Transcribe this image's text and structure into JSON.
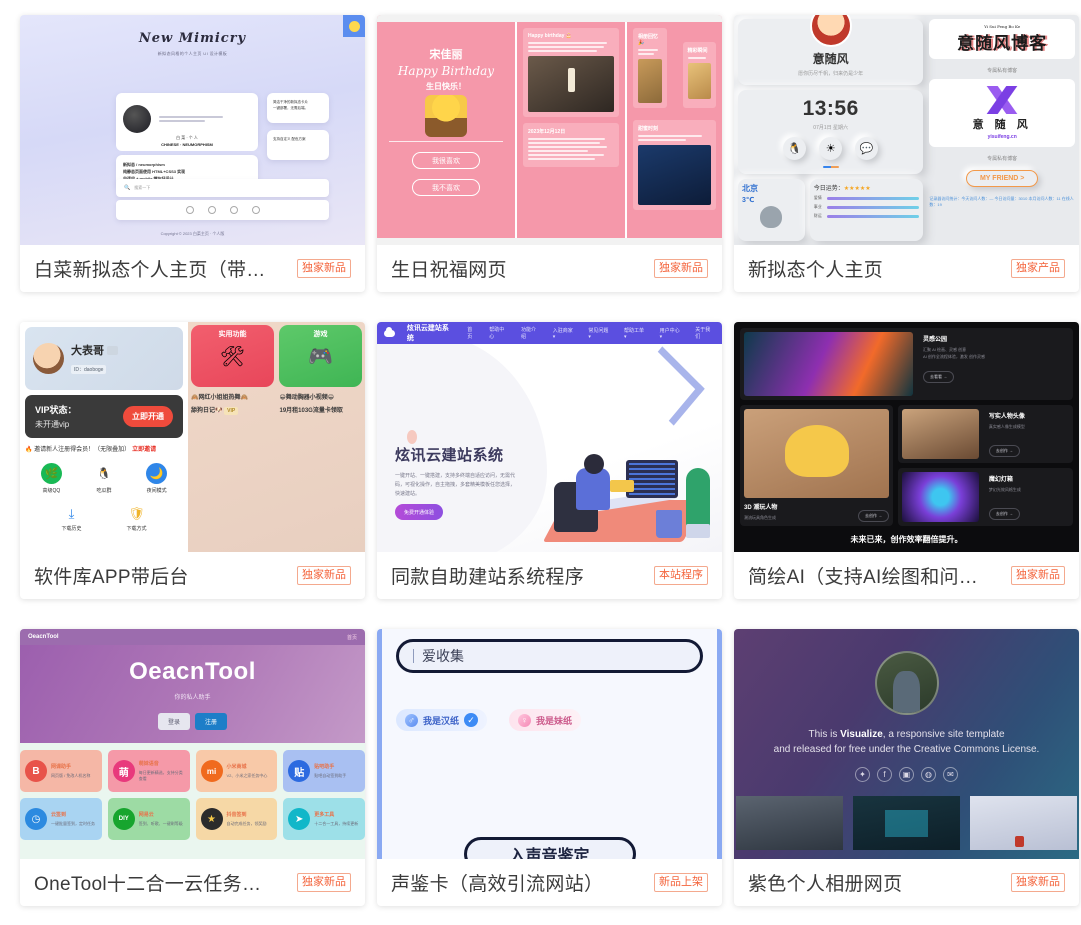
{
  "grid": {
    "cards": [
      {
        "id": "baicai-neumorphic-homepage",
        "title": "白菜新拟态个人主页（带…",
        "badge": "独家新品",
        "preview": {
          "brand": "New Mimicry",
          "subtitle": "新拟态风格的个人主页 UI 设计模板",
          "profile_name": "白 菜 · 个 人",
          "profile_sub": "CHINESE · NEUMORPHISM",
          "note_lines": [
            "新拟态 / neumorphism",
            "纯静态页面使用 HTML+CSS3 实现",
            "自适应 + mobile 端友好设计",
            ""
          ],
          "side_cards": [
            "简洁干净的新拟态卡片\n一键部署，无需后端。",
            "支持自定义 配色方案"
          ],
          "search_placeholder": "搜索一下",
          "footer": "Copyright © 2023 白菜主页 · 个人版"
        }
      },
      {
        "id": "birthday-blessing-page",
        "title": "生日祝福网页",
        "badge": "独家新品",
        "preview": {
          "name": "宋佳丽",
          "script": "Happy Birthday",
          "wish": "生日快乐！",
          "btn_yes": "我很喜欢",
          "btn_no": "我不喜欢",
          "cards": [
            {
              "header": "Happy birthday 🎂",
              "date": ""
            },
            {
              "header": "2023年12月12日",
              "date": ""
            },
            {
              "header": "相册回忆 🎉",
              "date": ""
            },
            {
              "header": "精彩瞬间",
              "date": ""
            },
            {
              "header": "甜蜜时刻",
              "date": ""
            }
          ]
        }
      },
      {
        "id": "neumorphic-homepage",
        "title": "新拟态个人主页",
        "badge": "独家产品",
        "preview": {
          "nickname": "意随风",
          "motto": "愿你历尽千帆，归来仍是少年",
          "time": "13:56",
          "date": "07月1日 星期六",
          "social_icons": [
            "qq-icon",
            "weather-sun-icon",
            "wechat-icon"
          ],
          "city": "北京",
          "temp": "3℃",
          "rating_label": "今日运势：",
          "stars": "★★★★★",
          "meters": [
            "爱情",
            "事业",
            "财运"
          ],
          "blog_logo_title": "意随风博客",
          "blog_logo_pinyin": "Yi Sui Feng Bo Ke",
          "blog_caption": "专属私有博客",
          "brand_name": "意 随 风",
          "brand_domain": "yisuifeng.cn",
          "brand_caption": "专属私有博客",
          "friend_btn": "MY FRIEND >",
          "visit_stats": "记录器访问统计：今天访问人数：—  今日访问量：3010  本月访问人数：11  在线人数：19"
        }
      },
      {
        "id": "software-library-app",
        "title": "软件库APP带后台",
        "badge": "独家新品",
        "preview": {
          "user_name": "大表哥",
          "user_id": "ID：daoboge",
          "vip_title": "VIP状态：",
          "vip_status": "未开通vip",
          "vip_button": "立即开通",
          "notice": "🔥 邀请新人注册得会员！（无限叠加）",
          "notice_link": "立即邀请",
          "apps": [
            {
              "label": "高级QQ",
              "icon": "leaf-icon"
            },
            {
              "label": "吃瓜群",
              "icon": "penguin-icon"
            },
            {
              "label": "夜间模式",
              "icon": "moon-icon"
            }
          ],
          "apps2": [
            {
              "label": "下载历史",
              "icon": "download-icon"
            },
            {
              "label": "下载方式",
              "icon": "shield-heart-icon"
            }
          ],
          "categories": [
            {
              "label": "实用功能",
              "icon": "tools-icon"
            },
            {
              "label": "游戏",
              "icon": "gamepad-icon"
            }
          ],
          "items": [
            "🙈网红小姐姐热舞🙈",
            "😁舞动胸器小视频😁",
            "舔狗日记🐶",
            "19月租103G流量卡领取"
          ],
          "vip_tag": "VIP"
        }
      },
      {
        "id": "cloud-site-builder-system",
        "title": "同款自助建站系统程序",
        "badge": "本站程序",
        "preview": {
          "logo": "炫讯云建站系统",
          "nav": [
            "首页",
            "帮助中心",
            "功能介绍",
            "入驻商家 ▾",
            "常见问题 ▾",
            "帮助工单 ▾",
            "用户中心 ▾",
            "关于我们"
          ],
          "heading": "炫讯云建站系统",
          "paragraph": "一键开站、一键搭建，支持多终端自适应访问，无需代码，可视化操作，自主拖拽，多套精美模板任您选择，快速建站。",
          "cta": "免费开通体验"
        }
      },
      {
        "id": "jianhui-ai",
        "title": "简绘AI（支持AI绘图和问…",
        "badge": "独家新品",
        "preview": {
          "blocks": [
            {
              "title": "灵感公园",
              "desc": "汇聚 AI 绘画、灵感 创意\nAI 创作全流程体验，激发 创作灵感",
              "btn": "去看看 →"
            },
            {
              "title": "3D 潮玩人物",
              "desc": "潮流玩具角色生成",
              "btn": "去创作 →"
            },
            {
              "title": "写实人物头像",
              "desc": "真实感人像生成模型",
              "btn": "去创作 →"
            },
            {
              "title": "魔幻灯箱",
              "desc": "梦幻光效风格生成",
              "btn": "去创作 →"
            }
          ],
          "tagline": "未来已来，创作效率翻倍提升。"
        }
      },
      {
        "id": "oeacntool",
        "title": "OneTool十二合一云任务…",
        "badge": "独家新品",
        "preview": {
          "navbar_brand": "OeacnTool",
          "navbar_right": "首页",
          "hero_title": "OeacnTool",
          "hero_sub": "你的私人助手",
          "btn1": "登录",
          "btn2": "注册",
          "tiles": [
            {
              "icon": "B",
              "title": "网课助手",
              "desc": "网页版 / 免改人机名称",
              "color": "#f5b7a6",
              "ic": "#e8534a"
            },
            {
              "icon": "萌",
              "title": "萌妹语音",
              "desc": "每日更新精选，支持分类查看",
              "color": "#f599a8",
              "ic": "#e8397c"
            },
            {
              "icon": "mi",
              "title": "小米商城",
              "desc": "V2、小米之家任务中心",
              "color": "#f8c9a8",
              "ic": "#f06a1e"
            },
            {
              "icon": "贴",
              "title": "贴吧助手",
              "desc": "贴吧自动签到助手",
              "color": "#a9c0f2",
              "ic": "#2c6ae0"
            },
            {
              "icon": "◷",
              "title": "云签到",
              "desc": "一键批量签到，定时任务",
              "color": "#a9d4f2",
              "ic": "#2c8ae0"
            },
            {
              "icon": "DIY",
              "title": "网易云",
              "desc": "签到、听歌、一键刷等级",
              "color": "#9ddba4",
              "ic": "#17a52e"
            },
            {
              "icon": "★",
              "title": "抖音签到",
              "desc": "自动完成任务，领奖励",
              "color": "#f6d8a6",
              "ic": "#2b2b2b"
            },
            {
              "icon": "➤",
              "title": "更多工具",
              "desc": "十二合一工具，持续更新",
              "color": "#9de0e8",
              "ic": "#11b7c9"
            }
          ]
        }
      },
      {
        "id": "voice-rating-card",
        "title": "声鉴卡（高效引流网站）",
        "badge": "新品上架",
        "preview": {
          "input_value": "爱收集",
          "gender_male": "我是汉纸",
          "gender_female": "我是妹纸",
          "male_symbol": "♂",
          "female_symbol": "♀",
          "checked_icon": "check-circle-icon",
          "submit": "入声音鉴定"
        }
      },
      {
        "id": "purple-photo-album",
        "title": "紫色个人相册网页",
        "badge": "独家新品",
        "preview": {
          "line1_pre": "This is ",
          "line1_brand": "Visualize",
          "line1_post": ", a responsive site template",
          "line2": "and released for free under the Creative Commons License.",
          "social": [
            "twitter-icon",
            "facebook-icon",
            "instagram-icon",
            "dribbble-icon",
            "mail-icon"
          ]
        }
      }
    ]
  },
  "colors": {
    "badge_text": "#f4653d",
    "badge_border": "#f4a98e",
    "title_text": "#3b3b3b",
    "page_bg": "#ffffff"
  }
}
